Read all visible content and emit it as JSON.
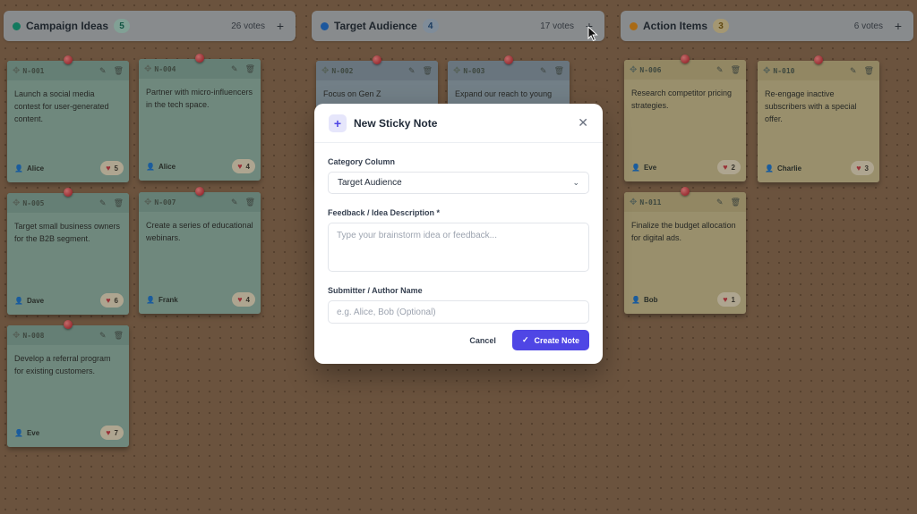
{
  "columns": [
    {
      "title": "Campaign Ideas",
      "count": "5",
      "votes": "26 votes",
      "dot_color": "#0f9f7a",
      "count_bg": "#a8d4c6",
      "count_color": "#0d6b54"
    },
    {
      "title": "Target Audience",
      "count": "4",
      "votes": "17 votes",
      "dot_color": "#1d6fd1",
      "count_bg": "#a5b9cc",
      "count_color": "#1c4a7d"
    },
    {
      "title": "Action Items",
      "count": "3",
      "votes": "6 votes",
      "dot_color": "#e08a16",
      "count_bg": "#d8c896",
      "count_color": "#7a5a0e"
    }
  ],
  "notes": [
    {
      "id": "N-001",
      "text": "Launch a social media contest for user-generated content.",
      "author": "Alice",
      "votes": "5",
      "color": "green"
    },
    {
      "id": "N-004",
      "text": "Partner with micro-influencers in the tech space.",
      "author": "Alice",
      "votes": "4",
      "color": "green"
    },
    {
      "id": "N-005",
      "text": "Target small business owners for the B2B segment.",
      "author": "Dave",
      "votes": "6",
      "color": "green"
    },
    {
      "id": "N-007",
      "text": "Create a series of educational webinars.",
      "author": "Frank",
      "votes": "4",
      "color": "green"
    },
    {
      "id": "N-008",
      "text": "Develop a referral program for existing customers.",
      "author": "Eve",
      "votes": "7",
      "color": "green"
    },
    {
      "id": "N-002",
      "text": "Focus on Gen Z",
      "author": "",
      "votes": "",
      "color": "blue"
    },
    {
      "id": "N-003",
      "text": "Expand our reach to young",
      "author": "",
      "votes": "",
      "color": "blue"
    },
    {
      "id": "N-006",
      "text": "Research competitor pricing strategies.",
      "author": "Eve",
      "votes": "2",
      "color": "yellow"
    },
    {
      "id": "N-010",
      "text": "Re-engage inactive subscribers with a special offer.",
      "author": "Charlie",
      "votes": "3",
      "color": "yellow"
    },
    {
      "id": "N-011",
      "text": "Finalize the budget allocation for digital ads.",
      "author": "Bob",
      "votes": "1",
      "color": "yellow"
    }
  ],
  "modal": {
    "title": "New Sticky Note",
    "category_label": "Category Column",
    "category_value": "Target Audience",
    "description_label": "Feedback / Idea Description *",
    "description_placeholder": "Type your brainstorm idea or feedback...",
    "author_label": "Submitter / Author Name",
    "author_placeholder": "e.g. Alice, Bob (Optional)",
    "cancel_label": "Cancel",
    "create_label": "Create Note"
  },
  "icons": {
    "add": "plus-icon",
    "drag": "drag-handle-icon",
    "edit": "pencil-icon",
    "delete": "trash-icon",
    "person": "person-icon",
    "heart": "heart-icon",
    "close": "close-icon",
    "chevron": "chevron-down-icon",
    "check": "check-icon"
  }
}
